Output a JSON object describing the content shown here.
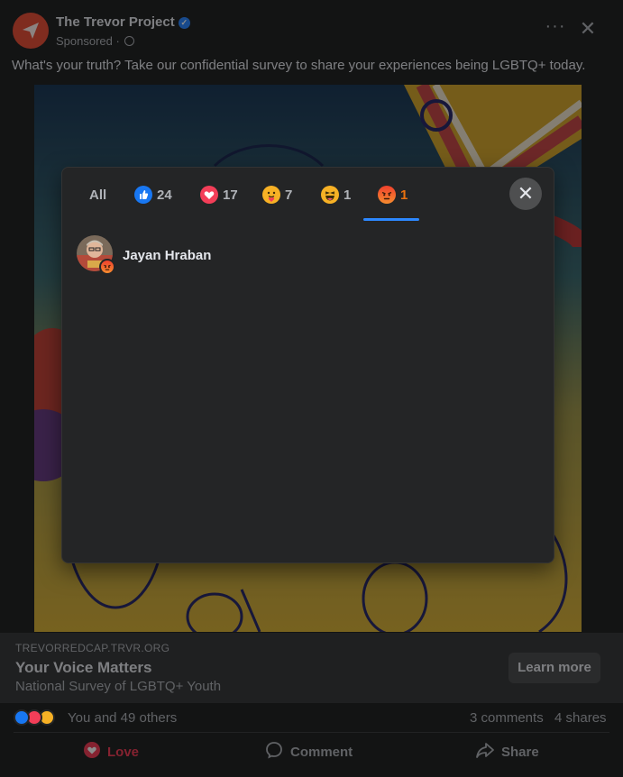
{
  "post": {
    "author": "The Trevor Project",
    "sponsored": "Sponsored · ",
    "caption": "What's your truth? Take our confidential survey to share your experiences being LGBTQ+ today."
  },
  "link_card": {
    "domain": "TREVORREDCAP.TRVR.ORG",
    "title": "Your Voice Matters",
    "subtitle": "National Survey of LGBTQ+ Youth",
    "cta": "Learn more"
  },
  "engagement": {
    "summary": "You and 49 others",
    "comments": "3 comments",
    "shares": "4 shares"
  },
  "actions": {
    "love": "Love",
    "comment": "Comment",
    "share": "Share"
  },
  "dialog": {
    "tabs": {
      "all": "All",
      "like": "24",
      "love": "17",
      "care": "7",
      "haha": "1",
      "angry": "1"
    },
    "selected_tab": "angry",
    "people": [
      {
        "name": "Jayan Hraban",
        "reaction": "angry"
      }
    ]
  },
  "colors": {
    "accent": "#2d88ff",
    "love": "#f33e58",
    "angry": "#e9710f"
  }
}
